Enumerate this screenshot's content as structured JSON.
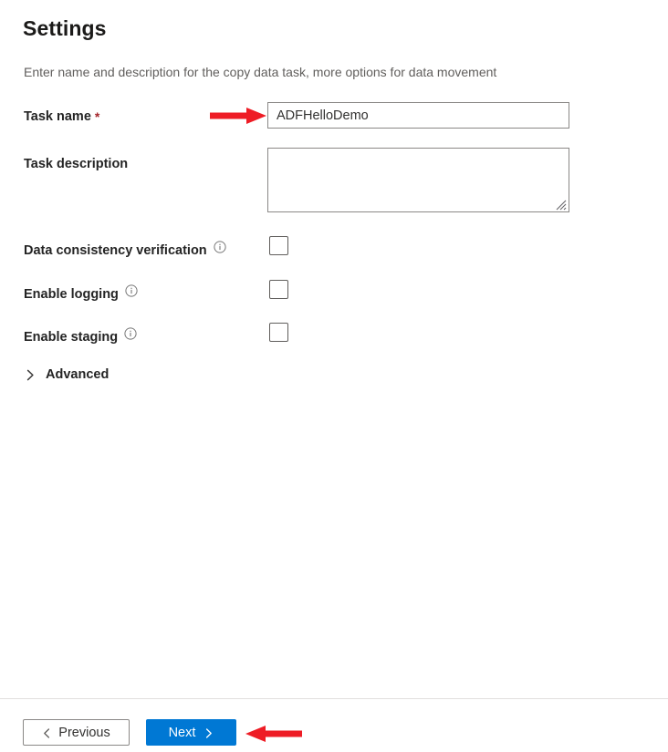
{
  "page": {
    "title": "Settings",
    "subtitle": "Enter name and description for the copy data task, more options for data movement"
  },
  "form": {
    "task_name": {
      "label": "Task name",
      "required_marker": "*",
      "value": "ADFHelloDemo",
      "placeholder": ""
    },
    "task_description": {
      "label": "Task description",
      "value": "",
      "placeholder": ""
    },
    "checkboxes": [
      {
        "label": "Data consistency verification",
        "checked": false,
        "info_icon": "info-circle-icon"
      },
      {
        "label": "Enable logging",
        "checked": false,
        "info_icon": "info-circle-icon"
      },
      {
        "label": "Enable staging",
        "checked": false,
        "info_icon": "info-circle-icon"
      }
    ],
    "advanced": {
      "label": "Advanced",
      "expanded": false,
      "icon": "chevron-right-icon"
    }
  },
  "footer": {
    "previous": {
      "label": "Previous",
      "icon": "chevron-left-icon"
    },
    "next": {
      "label": "Next",
      "icon": "chevron-right-icon"
    }
  },
  "annotations": {
    "color": "#ee1c25",
    "arrows": [
      {
        "name": "arrow-to-task-name-input",
        "direction": "right"
      },
      {
        "name": "arrow-to-next-button",
        "direction": "left"
      }
    ]
  },
  "colors": {
    "accent": "#0078d4",
    "text_primary": "#242424",
    "text_secondary": "#605e5c",
    "border": "#8a8886",
    "required": "#a4262c",
    "annotation_red": "#ee1c25"
  }
}
